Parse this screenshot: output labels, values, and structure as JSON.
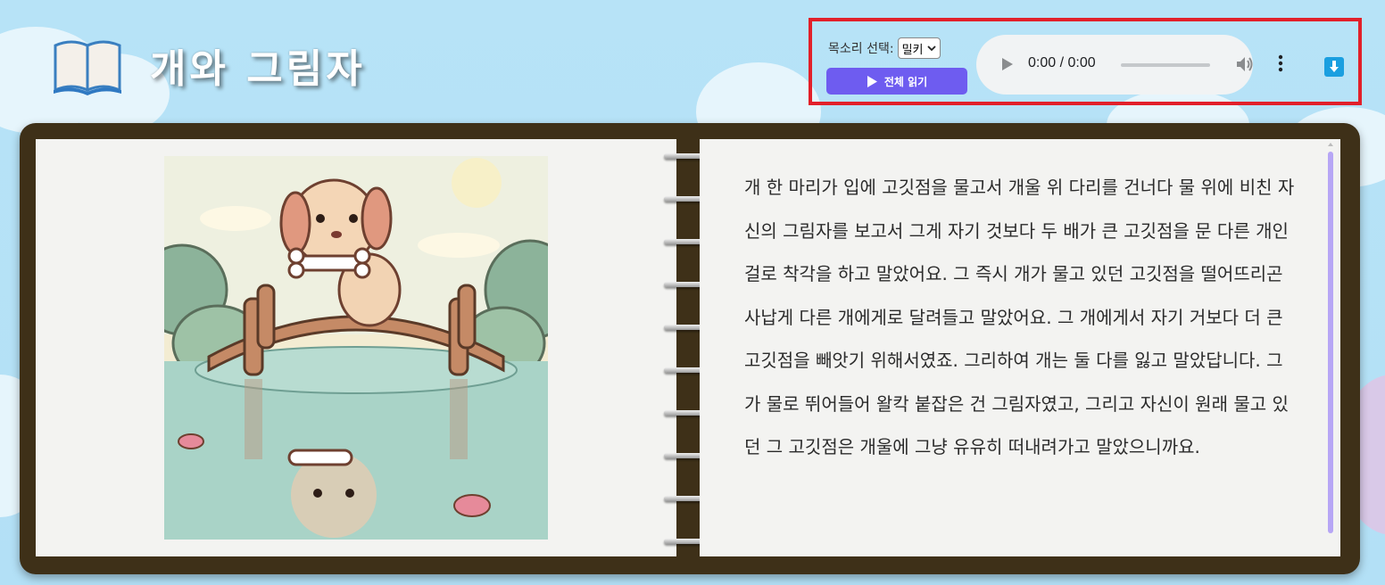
{
  "header": {
    "title": "개와 그림자",
    "icon": "open-book-icon"
  },
  "controls": {
    "voice_label": "목소리 선택:",
    "voice_selected": "밀키",
    "read_all_label": "전체 읽기",
    "audio_time": "0:00 / 0:00",
    "audio_progress": 0
  },
  "story": {
    "text": "개 한 마리가 입에 고깃점을 물고서 개울 위 다리를 건너다 물 위에 비친 자신의 그림자를 보고서 그게 자기 것보다 두 배가 큰 고깃점을 문 다른 개인 걸로 착각을 하고 말았어요. 그 즉시 개가 물고 있던 고깃점을 떨어뜨리곤 사납게 다른 개에게로 달려들고 말았어요. 그 개에게서 자기 거보다 더 큰 고깃점을 빼앗기 위해서였죠. 그리하여 개는 둘 다를 잃고 말았답니다. 그가 물로 뛰어들어 왈칵 붙잡은 건 그림자였고, 그리고 자신이 원래 물고 있던 그 고깃점은 개울에 그냥 유유히 떠내려가고 말았으니까요."
  },
  "colors": {
    "accent": "#6e5cf0",
    "highlight_border": "#e2202a",
    "notebook": "#3e3018",
    "download": "#1a9fe0"
  }
}
